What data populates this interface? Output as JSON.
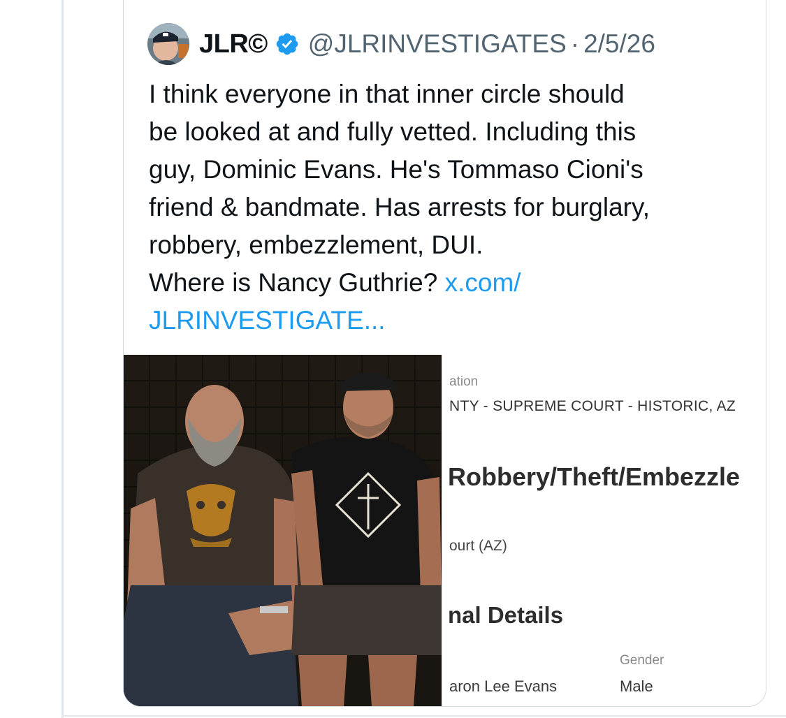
{
  "tweet": {
    "author_name": "JLR©",
    "handle": "@JLRINVESTIGATES",
    "separator": "·",
    "date": "2/5/26",
    "text_lines": [
      "I think everyone in that inner circle should",
      "be looked at and fully vetted. Including this",
      "guy, Dominic Evans. He's Tommaso Cioni's",
      "friend & bandmate. Has arrests for burglary,",
      "robbery, embezzlement, DUI."
    ],
    "last_line_text": "Where is Nancy Guthrie?",
    "link_part1": "x.com/",
    "link_part2": "JLRINVESTIGATE..."
  },
  "record": {
    "location_label": "ation",
    "court_name": "NTY - SUPREME COURT - HISTORIC, AZ",
    "offense": "Robbery/Theft/Embezzle",
    "court_type": "ourt (AZ)",
    "section_heading": "nal Details",
    "gender_label": "Gender",
    "name_value": "aron Lee Evans",
    "gender_value": "Male"
  },
  "icons": {
    "avatar": "avatar-photo",
    "verified": "verified-badge-icon"
  },
  "colors": {
    "text": "#0f1419",
    "secondary": "#536471",
    "link": "#1d9bf0",
    "verified": "#1d9bf0",
    "card_border": "#cfd9de"
  }
}
